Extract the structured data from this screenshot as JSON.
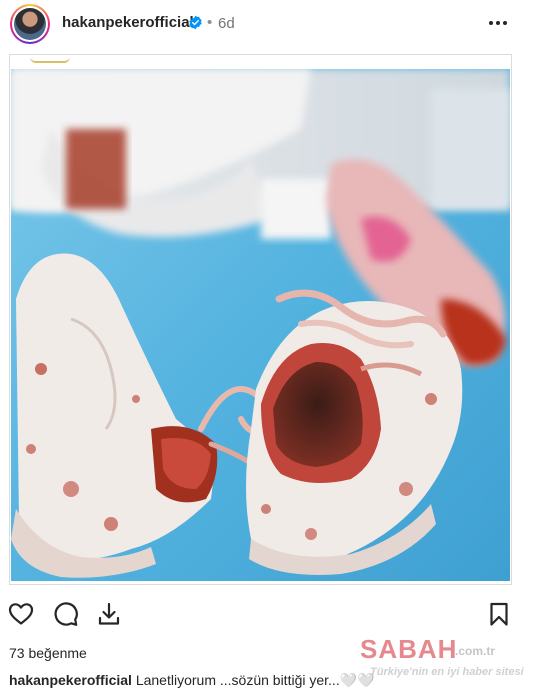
{
  "header": {
    "username": "hakanpekerofficial",
    "post_age": "6d",
    "separator": "•"
  },
  "photo": {
    "description_icon": "post-photo",
    "colors": {
      "sheet": "#5ab7e0",
      "shoe": "#f2ebe6",
      "blood": "#b2372a"
    }
  },
  "actions": {
    "like_icon": "heart-icon",
    "comment_icon": "comment-icon",
    "share_icon": "download-icon",
    "save_icon": "bookmark-icon"
  },
  "likes": {
    "text": "73 beğenme"
  },
  "caption": {
    "username": "hakanpekerofficial",
    "text": "Lanetliyorum ...sözün bittiği yer...🤍🤍"
  },
  "watermark": {
    "logo": "SABAH",
    "domain": ".com.tr",
    "tagline": "Türkiye'nin en iyi haber sitesi"
  }
}
